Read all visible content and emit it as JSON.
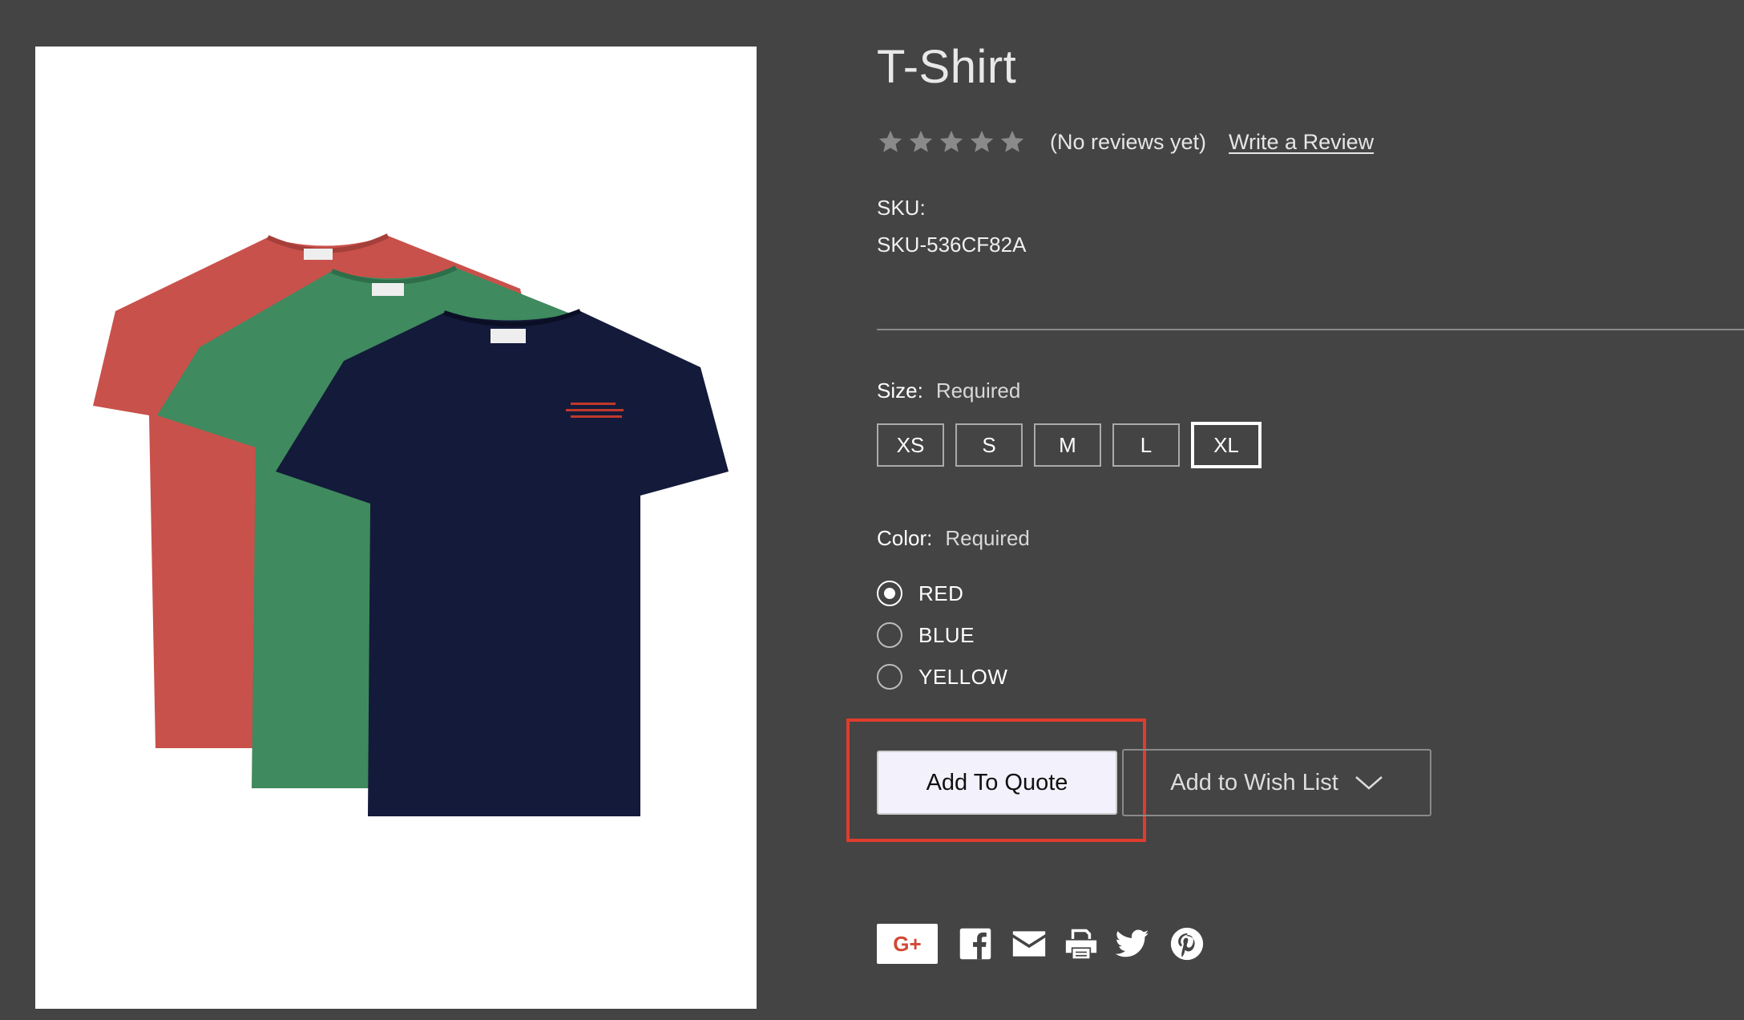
{
  "product": {
    "title": "T-Shirt",
    "image_alt": "Three t-shirts: red, green and navy",
    "colors_shown": [
      "#c9514b",
      "#3f8a5e",
      "#141a3a"
    ]
  },
  "rating": {
    "stars": 5,
    "filled": 0,
    "no_reviews_text": "(No reviews yet)",
    "write_review_label": "Write a Review"
  },
  "sku": {
    "label": "SKU:",
    "value": "SKU-536CF82A"
  },
  "size": {
    "label": "Size:",
    "required": "Required",
    "options": [
      "XS",
      "S",
      "M",
      "L",
      "XL"
    ],
    "selected": "XL"
  },
  "color": {
    "label": "Color:",
    "required": "Required",
    "options": [
      "RED",
      "BLUE",
      "YELLOW"
    ],
    "selected": "RED"
  },
  "actions": {
    "add_to_quote": "Add To Quote",
    "add_to_wishlist": "Add to Wish List",
    "highlight_color": "#e03c2c"
  },
  "share": {
    "icons": [
      "google-plus-icon",
      "facebook-icon",
      "email-icon",
      "print-icon",
      "twitter-icon",
      "pinterest-icon"
    ],
    "gplus_text": "G+"
  }
}
